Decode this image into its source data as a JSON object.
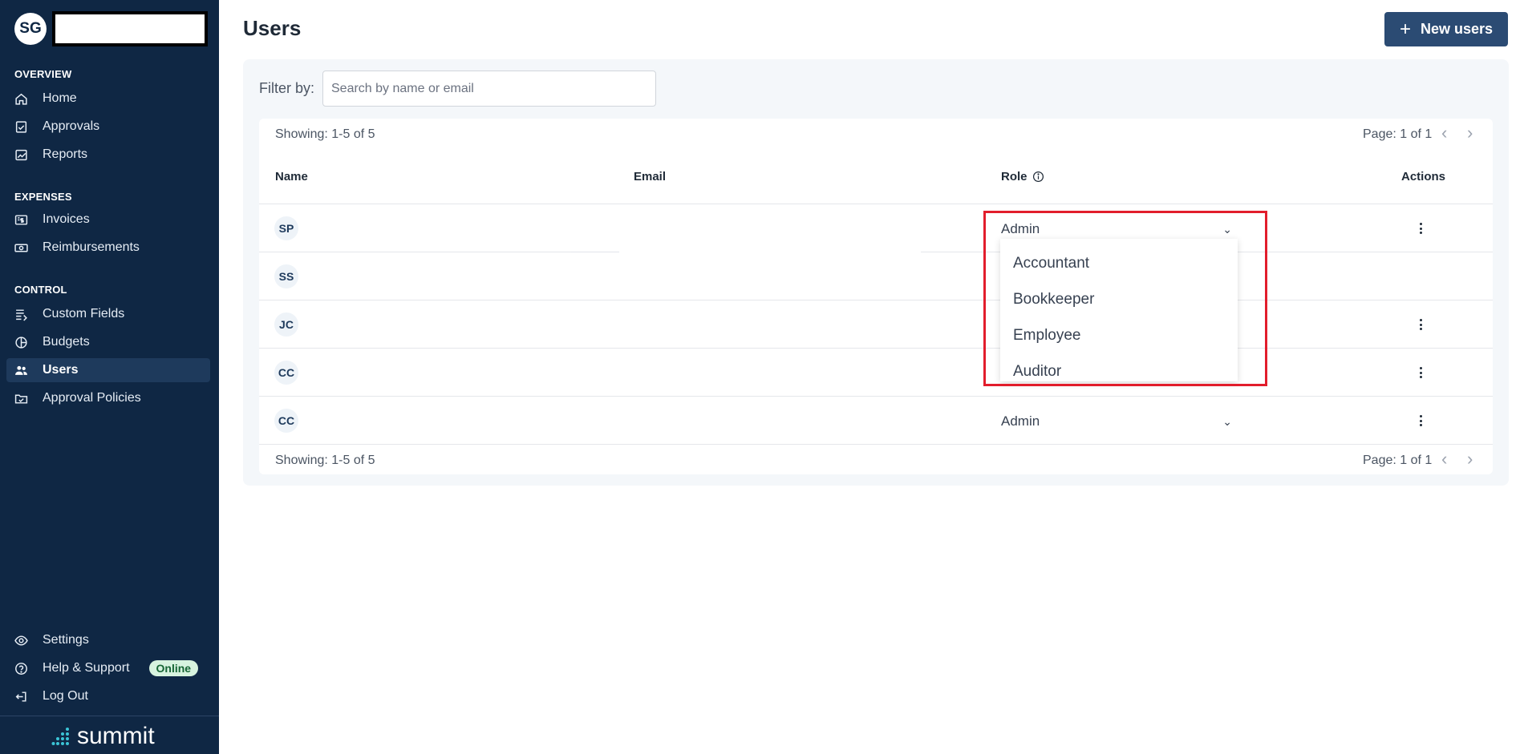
{
  "sidebar": {
    "user_initials": "SG",
    "sections": {
      "overview": "OVERVIEW",
      "expenses": "EXPENSES",
      "control": "CONTROL"
    },
    "items": [
      {
        "label": "Home",
        "icon": "home-icon"
      },
      {
        "label": "Approvals",
        "icon": "approvals-icon"
      },
      {
        "label": "Reports",
        "icon": "reports-icon"
      },
      {
        "label": "Invoices",
        "icon": "invoices-icon"
      },
      {
        "label": "Reimbursements",
        "icon": "reimbursements-icon"
      },
      {
        "label": "Custom Fields",
        "icon": "custom-fields-icon"
      },
      {
        "label": "Budgets",
        "icon": "budgets-icon"
      },
      {
        "label": "Users",
        "icon": "users-icon",
        "active": true
      },
      {
        "label": "Approval Policies",
        "icon": "approval-policies-icon"
      }
    ],
    "bottom": [
      {
        "label": "Settings",
        "icon": "settings-icon"
      },
      {
        "label": "Help & Support",
        "icon": "help-icon",
        "badge": "Online"
      },
      {
        "label": "Log Out",
        "icon": "logout-icon"
      }
    ],
    "logo_text": "summit"
  },
  "header": {
    "title": "Users",
    "new_button": "New users"
  },
  "filter": {
    "label": "Filter by:",
    "placeholder": "Search by name or email",
    "value": ""
  },
  "table": {
    "showing": "Showing: 1-5 of 5",
    "page": "Page: 1 of 1",
    "columns": [
      "Name",
      "Email",
      "Role",
      "Actions"
    ],
    "rows": [
      {
        "initials": "SP",
        "role": "Admin"
      },
      {
        "initials": "SS",
        "role": ""
      },
      {
        "initials": "JC",
        "role": ""
      },
      {
        "initials": "CC",
        "role": ""
      },
      {
        "initials": "CC",
        "role": "Admin"
      }
    ]
  },
  "dropdown": {
    "options": [
      "Accountant",
      "Bookkeeper",
      "Employee",
      "Auditor"
    ]
  },
  "colors": {
    "sidebar_bg": "#0f2744",
    "primary_button": "#2b4b73",
    "highlight": "#e21d2c",
    "online_badge_bg": "#d7f3df"
  }
}
